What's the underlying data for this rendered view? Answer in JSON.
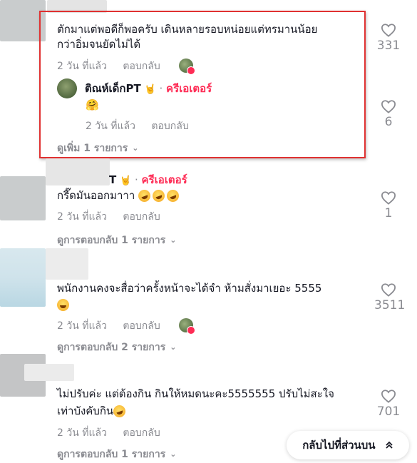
{
  "colors": {
    "creator_red": "#fe2c55",
    "meta_gray": "#8a8b91",
    "highlight_red": "#e03131"
  },
  "comments": [
    {
      "text_lines": [
        "ตักมาแต่พอดีก็พอครับ เดินหลายรอบหน่อยแต่ทรมานน้อย",
        "กว่าอิ่มจนยัดไม่ได้"
      ],
      "time": "2 วัน ที่แล้ว",
      "reply_label": "ตอบกลับ",
      "likes": "331",
      "reply": {
        "author": "ติณห์เด็กPT",
        "author_emoji": "🤘",
        "separator": "·",
        "creator_label": "ครีเอเตอร์",
        "text_emoji": "🤗",
        "time": "2 วัน ที่แล้ว",
        "reply_label": "ตอบกลับ",
        "likes": "6"
      },
      "more_label": "ดูเพิ่ม 1 รายการ"
    },
    {
      "author_partial": "T",
      "author_emoji": "🤘",
      "separator": "·",
      "creator_label": "ครีเอเตอร์",
      "text": "กรี๊ดมันออกมาาา",
      "time": "2 วัน ที่แล้ว",
      "reply_label": "ตอบกลับ",
      "likes": "1",
      "more_label": "ดูการตอบกลับ 1 รายการ"
    },
    {
      "text": "พนักงานคงจะสื่อว่าครั้งหน้าจะได้จำ ห้ามสั่งมาเยอะ 5555",
      "time": "2 วัน ที่แล้ว",
      "reply_label": "ตอบกลับ",
      "likes": "3511",
      "more_label": "ดูการตอบกลับ 2 รายการ"
    },
    {
      "text_lines": [
        "ไม่ปรับค่ะ แต่ต้องกิน กินให้หมดนะคะ5555555 ปรับไม่สะใจ",
        "เท่าบังคับกิน"
      ],
      "time": "2 วัน ที่แล้ว",
      "reply_label": "ตอบกลับ",
      "likes": "701",
      "more_label": "ดูการตอบกลับ 1 รายการ"
    }
  ],
  "back_to_top": {
    "label": "กลับไปที่ส่วนบน",
    "icon": "double-chevron-up-icon"
  }
}
